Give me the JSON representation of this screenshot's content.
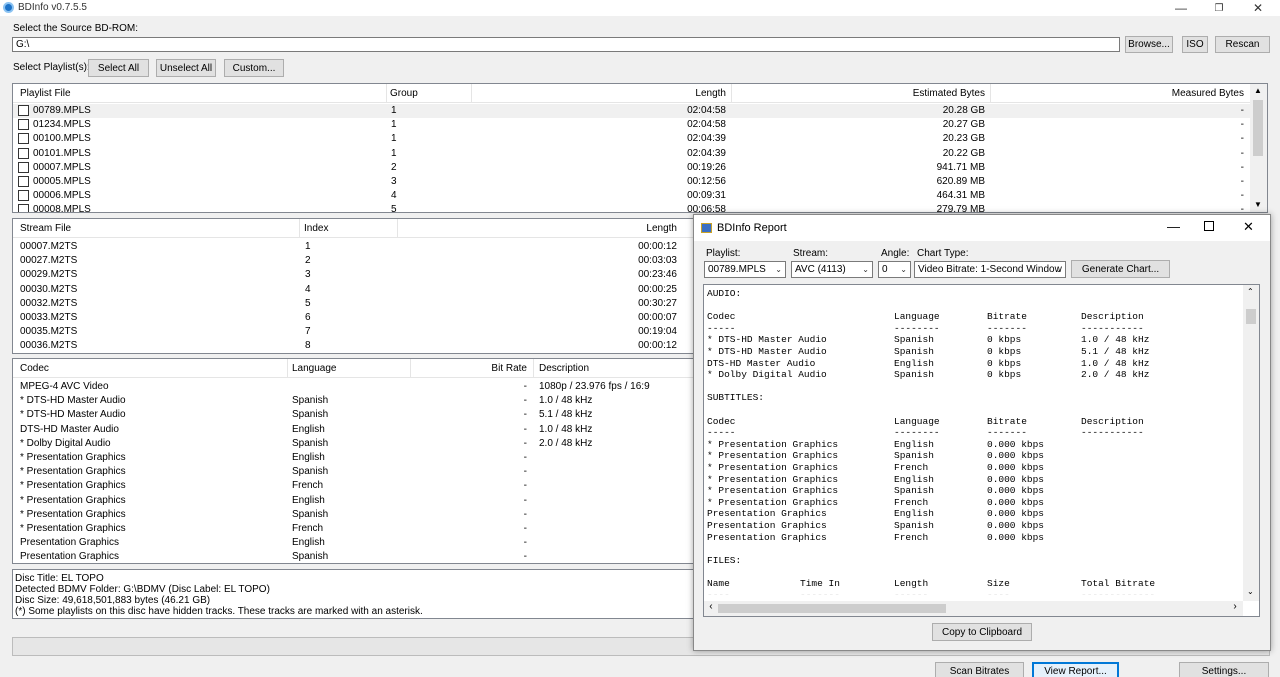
{
  "window": {
    "title": "BDInfo v0.7.5.5"
  },
  "source": {
    "label": "Select the Source BD-ROM:",
    "path": "G:\\",
    "browse": "Browse...",
    "iso": "ISO",
    "rescan": "Rescan"
  },
  "playlist_bar": {
    "label": "Select Playlist(s):",
    "select_all": "Select All",
    "unselect_all": "Unselect All",
    "custom": "Custom..."
  },
  "playlists": {
    "headers": [
      "Playlist File",
      "Group",
      "Length",
      "Estimated Bytes",
      "Measured Bytes"
    ],
    "rows": [
      [
        "00789.MPLS",
        "1",
        "02:04:58",
        "20.28 GB",
        "-"
      ],
      [
        "01234.MPLS",
        "1",
        "02:04:58",
        "20.27 GB",
        "-"
      ],
      [
        "00100.MPLS",
        "1",
        "02:04:39",
        "20.23 GB",
        "-"
      ],
      [
        "00101.MPLS",
        "1",
        "02:04:39",
        "20.22 GB",
        "-"
      ],
      [
        "00007.MPLS",
        "2",
        "00:19:26",
        "941.71 MB",
        "-"
      ],
      [
        "00005.MPLS",
        "3",
        "00:12:56",
        "620.89 MB",
        "-"
      ],
      [
        "00006.MPLS",
        "4",
        "00:09:31",
        "464.31 MB",
        "-"
      ],
      [
        "00008.MPLS",
        "5",
        "00:06:58",
        "279.79 MB",
        "-"
      ]
    ]
  },
  "streams": {
    "headers": [
      "Stream File",
      "Index",
      "Length"
    ],
    "rows": [
      [
        "00007.M2TS",
        "1",
        "00:00:12"
      ],
      [
        "00027.M2TS",
        "2",
        "00:03:03"
      ],
      [
        "00029.M2TS",
        "3",
        "00:23:46"
      ],
      [
        "00030.M2TS",
        "4",
        "00:00:25"
      ],
      [
        "00032.M2TS",
        "5",
        "00:30:27"
      ],
      [
        "00033.M2TS",
        "6",
        "00:00:07"
      ],
      [
        "00035.M2TS",
        "7",
        "00:19:04"
      ],
      [
        "00036.M2TS",
        "8",
        "00:00:12"
      ]
    ]
  },
  "codecs": {
    "headers": [
      "Codec",
      "Language",
      "Bit Rate",
      "Description"
    ],
    "rows": [
      [
        "MPEG-4 AVC Video",
        "",
        "-",
        "1080p / 23.976 fps / 16:9"
      ],
      [
        "* DTS-HD Master Audio",
        "Spanish",
        "-",
        "1.0 / 48 kHz"
      ],
      [
        "* DTS-HD Master Audio",
        "Spanish",
        "-",
        "5.1 / 48 kHz"
      ],
      [
        "DTS-HD Master Audio",
        "English",
        "-",
        "1.0 / 48 kHz"
      ],
      [
        "* Dolby Digital Audio",
        "Spanish",
        "-",
        "2.0 / 48 kHz"
      ],
      [
        "* Presentation Graphics",
        "English",
        "-",
        ""
      ],
      [
        "* Presentation Graphics",
        "Spanish",
        "-",
        ""
      ],
      [
        "* Presentation Graphics",
        "French",
        "-",
        ""
      ],
      [
        "* Presentation Graphics",
        "English",
        "-",
        ""
      ],
      [
        "* Presentation Graphics",
        "Spanish",
        "-",
        ""
      ],
      [
        "* Presentation Graphics",
        "French",
        "-",
        ""
      ],
      [
        "Presentation Graphics",
        "English",
        "-",
        ""
      ],
      [
        "Presentation Graphics",
        "Spanish",
        "-",
        ""
      ]
    ]
  },
  "disc_info": [
    "Disc Title: EL TOPO",
    "Detected BDMV Folder: G:\\BDMV (Disc Label: EL TOPO)",
    "Disc Size: 49,618,501,883 bytes (46.21 GB)",
    "(*) Some playlists on this disc have hidden tracks. These tracks are marked with an asterisk."
  ],
  "bottom_buttons": {
    "scan": "Scan Bitrates",
    "view": "View Report...",
    "settings": "Settings..."
  },
  "report": {
    "title": "BDInfo Report",
    "playlist_label": "Playlist:",
    "playlist_value": "00789.MPLS",
    "stream_label": "Stream:",
    "stream_value": "AVC (4113)",
    "angle_label": "Angle:",
    "angle_value": "0",
    "chart_label": "Chart Type:",
    "chart_value": "Video Bitrate: 1-Second Window",
    "generate": "Generate Chart...",
    "copy": "Copy to Clipboard",
    "lines": [
      {
        "t": "AUDIO:"
      },
      {
        "t": ""
      },
      {
        "c": [
          "Codec",
          "Language",
          "Bitrate",
          "Description"
        ]
      },
      {
        "c": [
          "-----",
          "--------",
          "-------",
          "-----------"
        ]
      },
      {
        "c": [
          "* DTS-HD Master Audio",
          "Spanish",
          "0 kbps",
          "1.0 / 48 kHz"
        ]
      },
      {
        "c": [
          "* DTS-HD Master Audio",
          "Spanish",
          "0 kbps",
          "5.1 / 48 kHz"
        ]
      },
      {
        "c": [
          "DTS-HD Master Audio",
          "English",
          "0 kbps",
          "1.0 / 48 kHz"
        ]
      },
      {
        "c": [
          "* Dolby Digital Audio",
          "Spanish",
          "0 kbps",
          "2.0 / 48 kHz"
        ]
      },
      {
        "t": ""
      },
      {
        "t": "SUBTITLES:"
      },
      {
        "t": ""
      },
      {
        "c": [
          "Codec",
          "Language",
          "Bitrate",
          "Description"
        ]
      },
      {
        "c": [
          "-----",
          "--------",
          "-------",
          "-----------"
        ]
      },
      {
        "c": [
          "* Presentation Graphics",
          "English",
          "0.000 kbps",
          ""
        ]
      },
      {
        "c": [
          "* Presentation Graphics",
          "Spanish",
          "0.000 kbps",
          ""
        ]
      },
      {
        "c": [
          "* Presentation Graphics",
          "French",
          "0.000 kbps",
          ""
        ]
      },
      {
        "c": [
          "* Presentation Graphics",
          "English",
          "0.000 kbps",
          ""
        ]
      },
      {
        "c": [
          "* Presentation Graphics",
          "Spanish",
          "0.000 kbps",
          ""
        ]
      },
      {
        "c": [
          "* Presentation Graphics",
          "French",
          "0.000 kbps",
          ""
        ]
      },
      {
        "c": [
          "Presentation Graphics",
          "English",
          "0.000 kbps",
          ""
        ]
      },
      {
        "c": [
          "Presentation Graphics",
          "Spanish",
          "0.000 kbps",
          ""
        ]
      },
      {
        "c": [
          "Presentation Graphics",
          "French",
          "0.000 kbps",
          ""
        ]
      },
      {
        "t": ""
      },
      {
        "t": "FILES:"
      },
      {
        "t": ""
      },
      {
        "f": [
          "Name",
          "Time In",
          "Length",
          "Size",
          "Total Bitrate"
        ]
      },
      {
        "f": [
          "----",
          "-------",
          "------",
          "----",
          "-------------"
        ]
      }
    ]
  }
}
